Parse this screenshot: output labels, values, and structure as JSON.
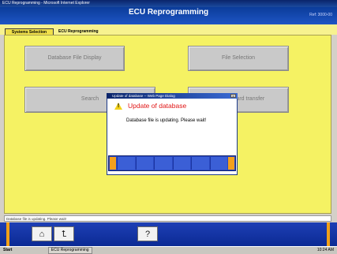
{
  "window": {
    "title": "ECU Reprogramming - Microsoft Internet Explorer"
  },
  "app": {
    "title": "ECU Reprogramming",
    "version_label": "Ref: 3000-00"
  },
  "tabs": [
    {
      "label": "Systems Selection"
    },
    {
      "label": "ECU Reprogramming"
    }
  ],
  "buttons": {
    "database_file_display": "Database File Display",
    "file_selection": "File Selection",
    "search": "Search",
    "memory_card_transfer": "Memory card transfer"
  },
  "dialog": {
    "title": "Update of database -- Web Page Dialog",
    "heading": "Update of database",
    "message": "Database file is updating. Please wait!",
    "close_glyph": "x",
    "warning_glyph": "!",
    "progress_segments": 6
  },
  "status_bar": {
    "text": "Database file is updating. Please wait!"
  },
  "toolbar": {
    "home_icon_glyph": "⌂",
    "back_icon_glyph": "⮤",
    "help_icon_glyph": "?"
  },
  "taskbar": {
    "start_label": "Start",
    "task_label": "ECU Reprogramming",
    "clock": "10:24 AM"
  },
  "colors": {
    "header_blue": "#0b3c9a",
    "main_yellow": "#f5f263",
    "dialog_heading_red": "#e01515",
    "toolbar_blue": "#1e3fb5",
    "accent_orange": "#f1a018"
  }
}
